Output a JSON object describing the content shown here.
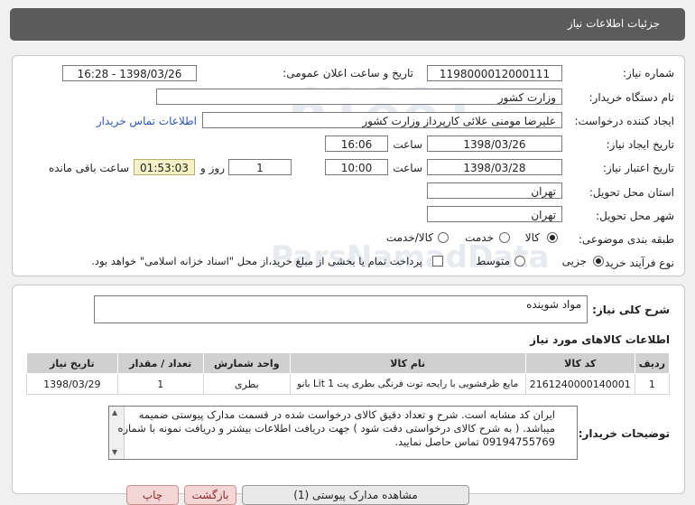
{
  "header": {
    "title": "جزئیات اطلاعات نیاز"
  },
  "form": {
    "need_number_label": "شماره نیاز:",
    "need_number": "1198000012000111",
    "announce_label": "تاریخ و ساعت اعلان عمومی:",
    "announce_value": "1398/03/26 - 16:28",
    "buyer_org_label": "نام دستگاه خریدار:",
    "buyer_org": "وزارت کشور",
    "creator_label": "ایجاد کننده درخواست:",
    "creator": "علیرضا مومنی علائی کارپرداز وزارت کشور",
    "contact_link": "اطلاعات تماس خریدار",
    "created_label": "تاریخ ایجاد نیاز:",
    "created_date": "1398/03/26",
    "time_word": "ساعت",
    "created_time": "16:06",
    "valid_label": "تاریخ اعتبار نیاز:",
    "valid_date": "1398/03/28",
    "valid_time": "10:00",
    "days": "1",
    "days_word": "روز و",
    "remaining": "01:53:03",
    "remaining_word": "ساعت باقی مانده",
    "province_label": "استان محل تحویل:",
    "province": "تهران",
    "city_label": "شهر محل تحویل:",
    "city": "تهران",
    "category_label": "طبقه بندی موضوعی:",
    "category_options": [
      "کالا",
      "خدمت",
      "کالا/خدمت"
    ],
    "process_label": "نوع فرآیند خرید :",
    "process_options": [
      "جزیی",
      "متوسط"
    ],
    "treasury_note": "پرداخت تمام یا بخشی از مبلغ خرید،از محل \"اسناد خزانه اسلامی\" خواهد بود."
  },
  "summary": {
    "label": "شرح کلی نیاز:",
    "value": "مواد شوینده"
  },
  "items": {
    "title": "اطلاعات کالاهای مورد نیاز",
    "headers": [
      "ردیف",
      "کد کالا",
      "نام کالا",
      "واحد شمارش",
      "تعداد / مقدار",
      "تاریخ نیاز"
    ],
    "rows": [
      [
        "1",
        "2161240000140001",
        "مایع ظرفشویی با رایحه توت فرنگی بطری پت 1 Lit بانو",
        "بطری",
        "1",
        "1398/03/29"
      ]
    ]
  },
  "buyer_notes": {
    "label": "توضیحات خریدار:",
    "text": "ایران کد مشابه است. شرح و تعداد دقیق کالای درخواست شده در قسمت مدارک پیوستی ضمیمه میباشد. ( به شرح کالای درخواستی دقت شود ) جهت دریافت اطلاعات بیشتر و دریافت نمونه با شماره 09194755769 تماس حاصل نمایید."
  },
  "footer": {
    "btn_view_docs": "مشاهده مدارک پیوستی (1)",
    "btn_back": "بازگشت",
    "btn_print": "چاپ"
  },
  "colors": {
    "header_bg": "#5b5b5b",
    "link": "#2b56b8",
    "timer_bg": "#f5f1c6",
    "table_header": "#d0d0d0"
  }
}
